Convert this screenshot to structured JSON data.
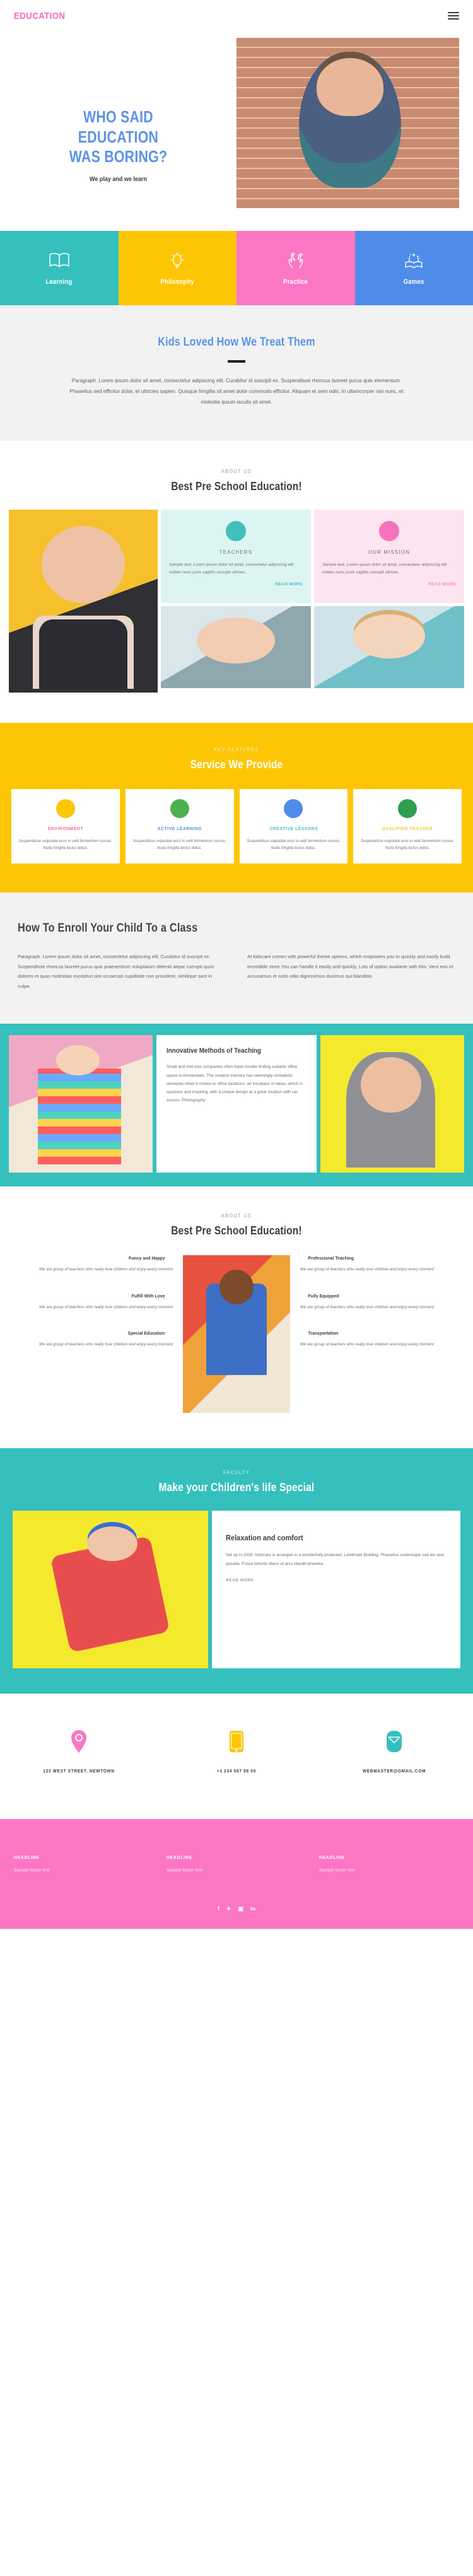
{
  "header": {
    "logo": "EDUCATION",
    "menu_icon": "hamburger-menu-icon"
  },
  "hero": {
    "line1": "WHO SAID",
    "line2": "EDUCATION",
    "line3": "WAS BORING?",
    "subtitle": "We play and we learn",
    "image_alt": "smiling-boy-by-brick-wall"
  },
  "features": [
    {
      "label": "Learning",
      "icon": "open-book-icon",
      "color": "#35c0bd"
    },
    {
      "label": "Philosophy",
      "icon": "lightbulb-icon",
      "color": "#fdc605"
    },
    {
      "label": "Practice",
      "icon": "high-five-icon",
      "color": "#fb77c3"
    },
    {
      "label": "Games",
      "icon": "magic-book-icon",
      "color": "#4f8cea"
    }
  ],
  "kids": {
    "title": "Kids Loved How We Treat Them",
    "paragraph": "Paragraph. Lorem ipsum dolor sit amet, consectetur adipiscing elit. Curabitur id suscipit ex. Suspendisse rhoncus laoreet purus quis elementum. Phasellus sed efficitur dolor, et ultricies sapien. Quisque fringilla sit amet dolor commodo efficitur. Aliquam et sem odio. In ullamcorper nisi nunc, et molestie ipsum iaculis sit amet."
  },
  "about": {
    "eyebrow": "ABOUT US",
    "title": "Best Pre School Education!",
    "cards": [
      {
        "title": "TEACHERS",
        "text": "Sample text. Lorem ipsum dolor sit amet, consectetur adipiscing elit nullam nunc justo sagittis suscipit ultrices.",
        "link": "READ MORE",
        "icon": "people-circle-icon",
        "color": "#3fc0bd"
      },
      {
        "title": "OUR MISSION",
        "text": "Sample text. Lorem ipsum dolor sit amet, consectetur adipiscing elit nullam nunc justo sagittis suscipit ultrices.",
        "link": "READ MORE",
        "icon": "diamond-circle-icon",
        "color": "#f573bb"
      }
    ]
  },
  "services": {
    "eyebrow": "KEY FEATURES",
    "title": "Service We Provide",
    "items": [
      {
        "title": "ENVIRONMENT",
        "color": "#f2689c",
        "icon": "child-reading-avatar",
        "text": "Suspendisse vulputate eros in velit fermentum cursus. Nulla fringilla lectus tellus."
      },
      {
        "title": "ACTIVE LEARNING",
        "color": "#4f8cea",
        "icon": "two-children-avatar",
        "text": "Suspendisse vulputate eros in velit fermentum cursus. Nulla fringilla lectus tellus."
      },
      {
        "title": "CREATIVE LESSONS",
        "color": "#3fc0bd",
        "icon": "boy-girl-avatar",
        "text": "Suspendisse vulputate eros in velit fermentum cursus. Nulla fringilla lectus tellus."
      },
      {
        "title": "QUALIFIED TEACHER",
        "color": "#f0c83d",
        "icon": "teacher-avatar",
        "text": "Suspendisse vulputate eros in velit fermentum cursus. Nulla fringilla lectus tellus."
      }
    ]
  },
  "enroll": {
    "title": "How To Enroll Your Child To a Class",
    "left": "Paragraph. Lorem ipsum dolor sit amet, consectetur adipiscing elit. Curabitur id suscipit ex. Suspendisse rhoncus laoreet purus quis praesentium voluptatum deleniti atque corrupti quos dolores et quas molestias excepturi sint occaecati cupiditate non provident, similique sunt in culpa.",
    "right": "At kidzcare comes with powerful theme options, which empowers you to quickly and easily build incredible store.You can handle it easily and quickly. Lots of option availavle with this. Vero eos et accusamus et iusto odio dignissimos ducimus qui blanditiis"
  },
  "innovative": {
    "title": "Innovative Methods of Teaching",
    "text": "Small and mid-size companies often have trouble finding suitable office space in Amsterdam. The creative industry has seemingly unrealistic demands when it comes to office locations: an incubator of ideas, which is spacious and inspiring, with a unique design at a great location with car access. Photography",
    "left_image_alt": "girl-in-rainbow-dress",
    "right_image_alt": "boy-shouting-yellow-background"
  },
  "about2": {
    "eyebrow": "ABOUT US",
    "title": "Best Pre School Education!",
    "image_alt": "boy-jumping-skateboard",
    "left_items": [
      {
        "title": "Funny and Happy",
        "text": "We are group of teachers who really love children and enjoy every moment"
      },
      {
        "title": "Fulfill With Love",
        "text": "We are group of teachers who really love children and enjoy every moment"
      },
      {
        "title": "Special Education",
        "text": "We are group of teachers who really love children and enjoy every moment"
      }
    ],
    "right_items": [
      {
        "title": "Professional Teaching",
        "text": "We are group of teachers who really love children and enjoy every moment"
      },
      {
        "title": "Fully Equipped",
        "text": "We are group of teachers who really love children and enjoy every moment"
      },
      {
        "title": "Transportation",
        "text": "We are group of teachers who really love children and enjoy every moment"
      }
    ]
  },
  "faculty": {
    "eyebrow": "FACULTY",
    "title": "Make your Children's life Special",
    "image_alt": "child-running-yellow-background",
    "card_title": "Relaxation and comfort",
    "card_text": "Set up in 2000, Kidzcare is arranged in a wonderfully protected, Landmark Building. Phasellus scelerisque sed leo quis gravida. Fusce lobortis libero ut arcu blandit pharetra.",
    "card_link": "READ MORE"
  },
  "contact": [
    {
      "text": "123 WEST STREET, NEWTOWN",
      "icon": "map-pin-icon",
      "color": "#fb77c3"
    },
    {
      "text": "+1 234 567 89 00",
      "icon": "mobile-phone-icon",
      "color": "#fdc605"
    },
    {
      "text": "WEBMASTER@GMAIL.COM",
      "icon": "envelope-icon",
      "color": "#35c0bd"
    }
  ],
  "footer": {
    "columns": [
      {
        "headline": "HEADLINE",
        "text": "Sample footer text"
      },
      {
        "headline": "HEADLINE",
        "text": "Sample footer text"
      },
      {
        "headline": "HEADLINE",
        "text": "Sample footer text"
      }
    ],
    "socials": [
      {
        "name": "facebook-icon",
        "glyph": "f"
      },
      {
        "name": "twitter-icon",
        "glyph": "✈"
      },
      {
        "name": "instagram-icon",
        "glyph": "▣"
      },
      {
        "name": "linkedin-icon",
        "glyph": "in"
      }
    ]
  }
}
